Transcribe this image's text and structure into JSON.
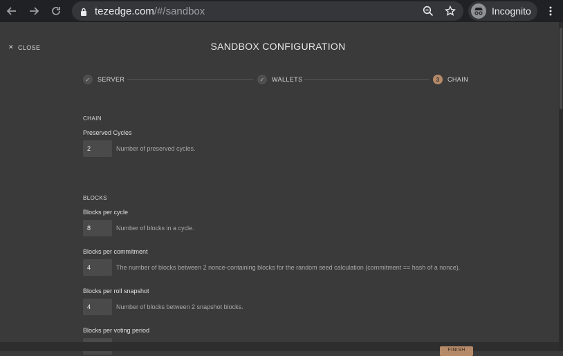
{
  "browser": {
    "url_host": "tezedge.com",
    "url_path": "/#/sandbox",
    "profile_label": "Incognito",
    "icons": {
      "back": "arrow-left-icon",
      "forward": "arrow-right-icon",
      "reload": "reload-icon",
      "lock": "lock-icon",
      "zoom": "zoom-icon",
      "bookmark": "star-icon",
      "incognito": "incognito-icon",
      "menu": "kebab-menu-icon"
    }
  },
  "page": {
    "close_label": "CLOSE",
    "title": "SANDBOX CONFIGURATION",
    "accent_color": "#b58a68",
    "stepper": {
      "steps": [
        {
          "label": "SERVER",
          "state": "done"
        },
        {
          "label": "WALLETS",
          "state": "done"
        },
        {
          "number": "3",
          "label": "CHAIN",
          "state": "active"
        }
      ]
    },
    "sections": {
      "chain": {
        "title": "CHAIN",
        "fields": [
          {
            "label": "Preserved Cycles",
            "value": "2",
            "description": "Number of preserved cycles."
          }
        ]
      },
      "blocks": {
        "title": "BLOCKS",
        "fields": [
          {
            "label": "Blocks per cycle",
            "value": "8",
            "description": "Number of blocks in a cycle."
          },
          {
            "label": "Blocks per commitment",
            "value": "4",
            "description": "The number of blocks between 2 nonce-containing blocks for the random seed calculation (commitment == hash of a nonce)."
          },
          {
            "label": "Blocks per roll snapshot",
            "value": "4",
            "description": "Number of blocks between 2 snapshot blocks."
          },
          {
            "label": "Blocks per voting period",
            "value": ""
          }
        ]
      }
    },
    "finish_label": "FINISH"
  }
}
